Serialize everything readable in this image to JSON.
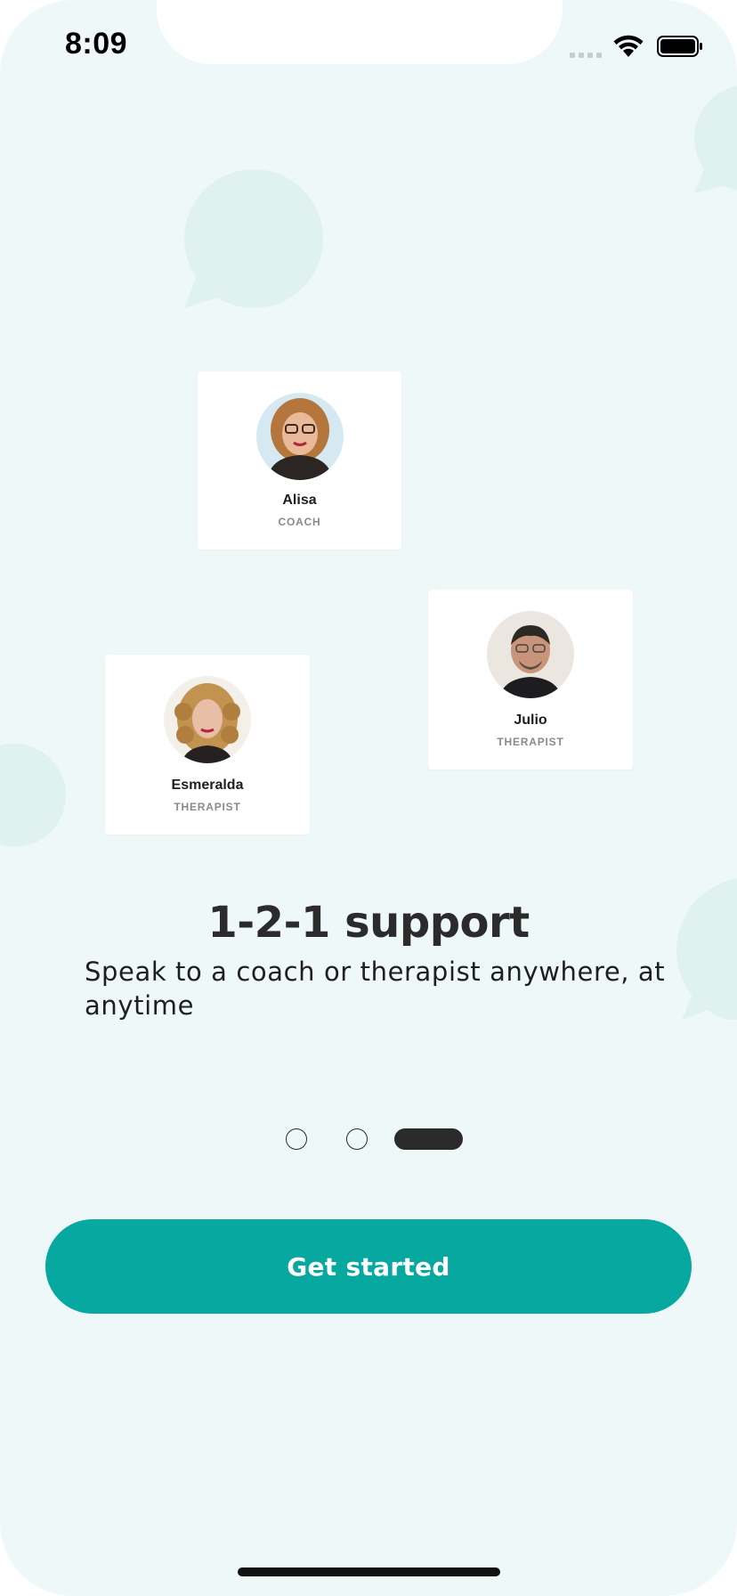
{
  "status_bar": {
    "time": "8:09",
    "icons": [
      "cellular-signal-icon",
      "wifi-icon",
      "battery-icon"
    ]
  },
  "coaches": [
    {
      "name": "Alisa",
      "role": "COACH"
    },
    {
      "name": "Julio",
      "role": "THERAPIST"
    },
    {
      "name": "Esmeralda",
      "role": "THERAPIST"
    }
  ],
  "onboarding": {
    "title": "1-2-1 support",
    "subtitle": "Speak to a coach or therapist anywhere, at anytime",
    "pages": 3,
    "current_page": 3
  },
  "cta": {
    "label": "Get started"
  },
  "colors": {
    "background": "#eff8f8",
    "accent": "#06a8a0",
    "bubble": "#e0f2f0",
    "text_dark": "#2b2b2b"
  }
}
